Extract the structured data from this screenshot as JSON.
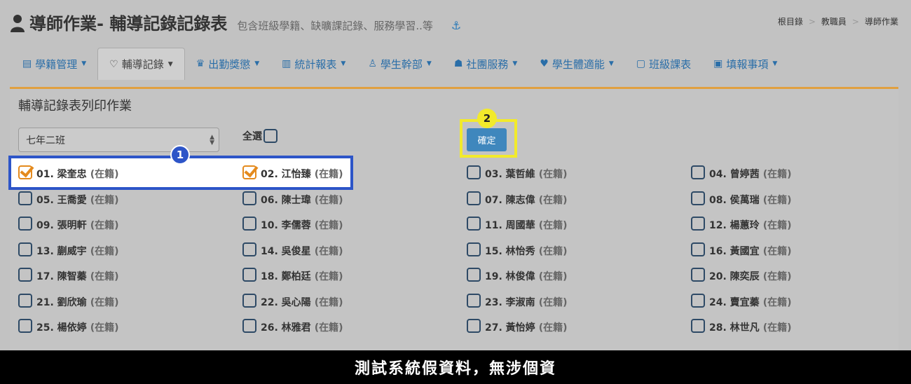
{
  "header": {
    "title": "導師作業- 輔導記錄記錄表",
    "subtitle": "包含班級學籍、缺曠課記錄、服務學習..等",
    "icons": {
      "user": "user-icon",
      "anchor": "anchor-icon"
    }
  },
  "breadcrumb": [
    "根目錄",
    "教職員",
    "導師作業"
  ],
  "nav": [
    {
      "label": "學籍管理",
      "icon": "id-card-icon",
      "glyph": "▤",
      "caret": true,
      "active": false
    },
    {
      "label": "輔導記錄",
      "icon": "heart-icon",
      "glyph": "♡",
      "caret": true,
      "active": true
    },
    {
      "label": "出勤獎懲",
      "icon": "trophy-icon",
      "glyph": "♛",
      "caret": true,
      "active": false
    },
    {
      "label": "統計報表",
      "icon": "bar-chart-icon",
      "glyph": "▥",
      "caret": true,
      "active": false
    },
    {
      "label": "學生幹部",
      "icon": "person-icon",
      "glyph": "♙",
      "caret": true,
      "active": false
    },
    {
      "label": "社團服務",
      "icon": "group-icon",
      "glyph": "☗",
      "caret": true,
      "active": false
    },
    {
      "label": "學生體適能",
      "icon": "heartbeat-icon",
      "glyph": "♥",
      "caret": true,
      "active": false
    },
    {
      "label": "班級課表",
      "icon": "note-icon",
      "glyph": "▢",
      "caret": false,
      "active": false
    },
    {
      "label": "填報事項",
      "icon": "form-icon",
      "glyph": "▣",
      "caret": true,
      "active": false
    }
  ],
  "panel": {
    "title": "輔導記錄表列印作業",
    "class_select_value": "七年二班",
    "select_all_label": "全選",
    "confirm_label": "確定"
  },
  "students": [
    {
      "label": "01. 梁奎忠",
      "status": "(在籍)",
      "checked": true
    },
    {
      "label": "02. 江怡臻",
      "status": "(在籍)",
      "checked": true
    },
    {
      "label": "03. 葉哲維",
      "status": "(在籍)",
      "checked": false
    },
    {
      "label": "04. 曾婷茜",
      "status": "(在籍)",
      "checked": false
    },
    {
      "label": "05. 王喬愛",
      "status": "(在籍)",
      "checked": false
    },
    {
      "label": "06. 陳士瑋",
      "status": "(在籍)",
      "checked": false
    },
    {
      "label": "07. 陳志偉",
      "status": "(在籍)",
      "checked": false
    },
    {
      "label": "08. 侯萬瑞",
      "status": "(在籍)",
      "checked": false
    },
    {
      "label": "09. 張明軒",
      "status": "(在籍)",
      "checked": false
    },
    {
      "label": "10. 李儒蓉",
      "status": "(在籍)",
      "checked": false
    },
    {
      "label": "11. 周國華",
      "status": "(在籍)",
      "checked": false
    },
    {
      "label": "12. 楊蕙玲",
      "status": "(在籍)",
      "checked": false
    },
    {
      "label": "13. 蒯威宇",
      "status": "(在籍)",
      "checked": false
    },
    {
      "label": "14. 吳俊星",
      "status": "(在籍)",
      "checked": false
    },
    {
      "label": "15. 林怡秀",
      "status": "(在籍)",
      "checked": false
    },
    {
      "label": "16. 黃國宜",
      "status": "(在籍)",
      "checked": false
    },
    {
      "label": "17. 陳智蓁",
      "status": "(在籍)",
      "checked": false
    },
    {
      "label": "18. 鄭柏廷",
      "status": "(在籍)",
      "checked": false
    },
    {
      "label": "19. 林俊偉",
      "status": "(在籍)",
      "checked": false
    },
    {
      "label": "20. 陳奕辰",
      "status": "(在籍)",
      "checked": false
    },
    {
      "label": "21. 劉欣瑜",
      "status": "(在籍)",
      "checked": false
    },
    {
      "label": "22. 吳心陽",
      "status": "(在籍)",
      "checked": false
    },
    {
      "label": "23. 李淑南",
      "status": "(在籍)",
      "checked": false
    },
    {
      "label": "24. 賣宜蓁",
      "status": "(在籍)",
      "checked": false
    },
    {
      "label": "25. 楊依婷",
      "status": "(在籍)",
      "checked": false
    },
    {
      "label": "26. 林雅君",
      "status": "(在籍)",
      "checked": false
    },
    {
      "label": "27. 黃怡婷",
      "status": "(在籍)",
      "checked": false
    },
    {
      "label": "28. 林世凡",
      "status": "(在籍)",
      "checked": false
    }
  ],
  "markers": {
    "step1": "1",
    "step2": "2"
  },
  "footer_text": "測試系統假資料，無涉個資",
  "colors": {
    "accent": "#2a6ea8",
    "highlight_blue": "#2d55c8",
    "highlight_yellow": "#f2ea2b",
    "checkbox_checked": "#e48a1d",
    "panel_border": "#e0a040"
  }
}
